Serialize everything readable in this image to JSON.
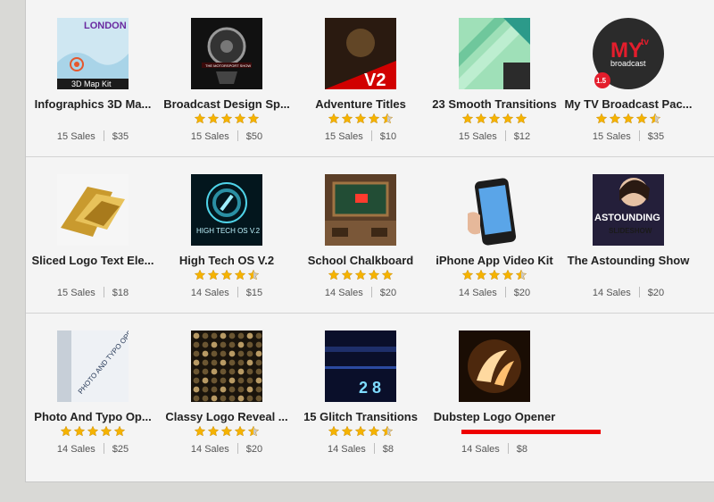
{
  "rows": [
    [
      {
        "title": "Infographics 3D Ma...",
        "rating": 0,
        "sales": "15 Sales",
        "price": "$35",
        "thumb": "thumb-infographics-3d-map",
        "thumb_text": "LONDON",
        "thumb_caption": "3D Map Kit"
      },
      {
        "title": "Broadcast Design Sp...",
        "rating": 5,
        "sales": "15 Sales",
        "price": "$50",
        "thumb": "thumb-broadcast-design",
        "thumb_text": "THE MOTORSPORT SHOW"
      },
      {
        "title": "Adventure Titles",
        "rating": 4.5,
        "sales": "15 Sales",
        "price": "$10",
        "thumb": "thumb-adventure-titles",
        "thumb_text": "V2"
      },
      {
        "title": "23 Smooth Transitions",
        "rating": 5,
        "sales": "15 Sales",
        "price": "$12",
        "thumb": "thumb-smooth-transitions"
      },
      {
        "title": "My TV Broadcast Pac...",
        "rating": 4.5,
        "sales": "15 Sales",
        "price": "$35",
        "thumb": "thumb-my-tv-broadcast",
        "thumb_text": "MY",
        "thumb_sub": "tv",
        "thumb_caption": "broadcast",
        "thumb_badge": "1.5"
      }
    ],
    [
      {
        "title": "Sliced Logo Text Ele...",
        "rating": 0,
        "sales": "15 Sales",
        "price": "$18",
        "thumb": "thumb-sliced-logo"
      },
      {
        "title": "High Tech OS V.2",
        "rating": 4.5,
        "sales": "14 Sales",
        "price": "$15",
        "thumb": "thumb-high-tech-os",
        "thumb_text": "HIGH TECH OS V.2"
      },
      {
        "title": "School Chalkboard",
        "rating": 5,
        "sales": "14 Sales",
        "price": "$20",
        "thumb": "thumb-school-chalkboard"
      },
      {
        "title": "iPhone App Video Kit",
        "rating": 4.5,
        "sales": "14 Sales",
        "price": "$20",
        "thumb": "thumb-iphone-app"
      },
      {
        "title": "The Astounding Show",
        "rating": 0,
        "sales": "14 Sales",
        "price": "$20",
        "thumb": "thumb-astounding-show",
        "thumb_text": "ASTOUNDING",
        "thumb_caption": "SLIDESHOW"
      }
    ],
    [
      {
        "title": "Photo And Typo Op...",
        "rating": 5,
        "sales": "14 Sales",
        "price": "$25",
        "thumb": "thumb-photo-typo",
        "thumb_text": "PHOTO AND TYPO OPENER"
      },
      {
        "title": "Classy Logo Reveal ...",
        "rating": 4.5,
        "sales": "14 Sales",
        "price": "$20",
        "thumb": "thumb-classy-logo"
      },
      {
        "title": "15 Glitch Transitions",
        "rating": 4.5,
        "sales": "14 Sales",
        "price": "$8",
        "thumb": "thumb-glitch-transitions",
        "thumb_text": "2 8"
      },
      {
        "title": "Dubstep Logo Opener",
        "rating": 0,
        "sales": "14 Sales",
        "price": "$8",
        "thumb": "thumb-dubstep-logo",
        "highlighted": true
      }
    ]
  ],
  "colors": {
    "star_full": "#f5b300",
    "star_empty": "#c9c9c9",
    "highlight_underline": "#ee0000",
    "panel_bg": "#f4f4f4"
  }
}
